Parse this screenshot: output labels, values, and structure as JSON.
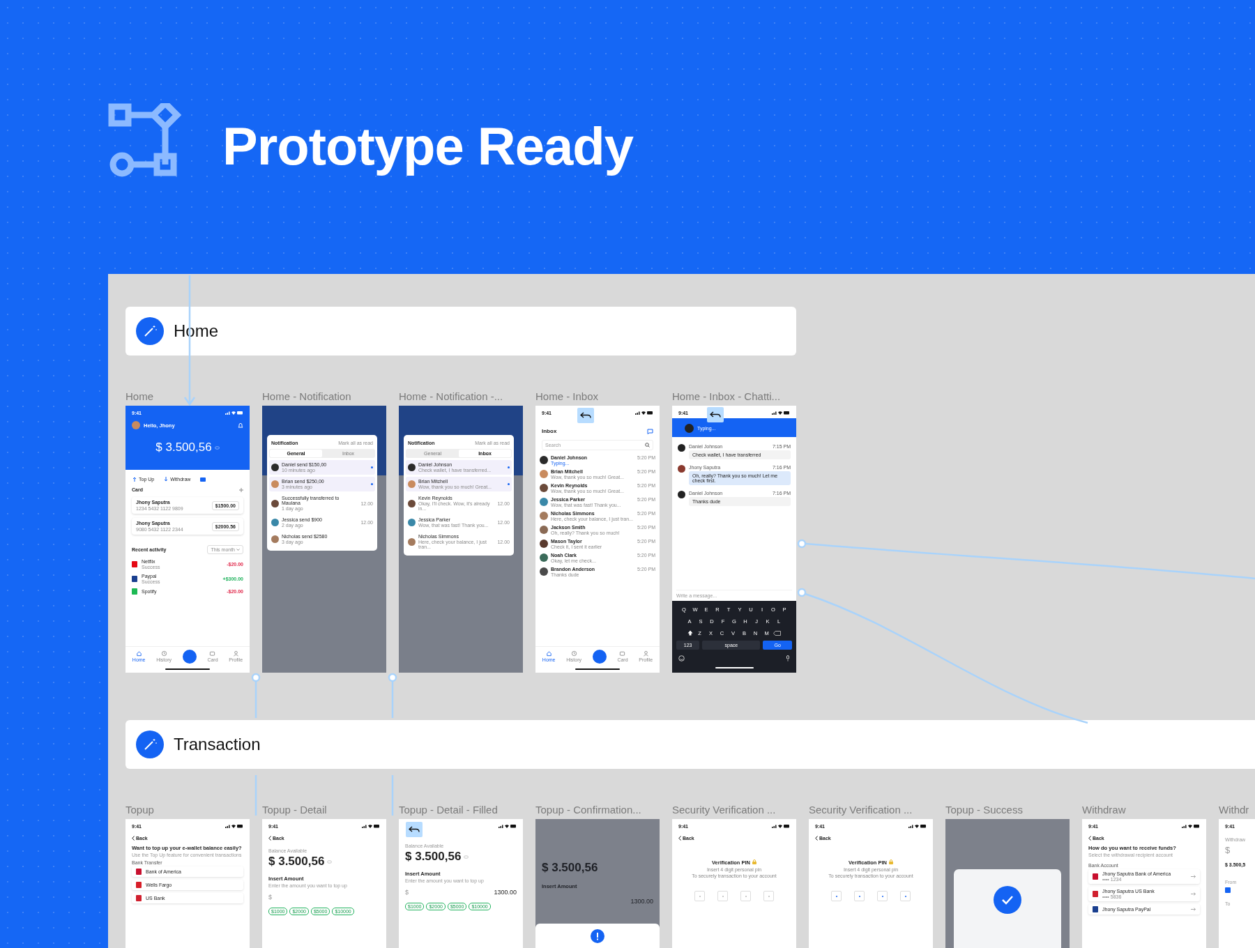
{
  "header": {
    "title": "Prototype Ready"
  },
  "sections": [
    {
      "title": "Home",
      "frames": [
        {
          "label": "Home",
          "kind": "home",
          "time": "9:41",
          "greeting": "Hello, Jhony",
          "balance": "$ 3.500,56",
          "actions": [
            "Top Up",
            "Withdraw"
          ],
          "card_title": "Card",
          "cards": [
            {
              "name": "Jhony Saputra",
              "number": "1234 5432 1122 9809",
              "amount": "$1500.00"
            },
            {
              "name": "Jhony Saputra",
              "number": "9080 5432 1122 2344",
              "amount": "$2000.56"
            }
          ],
          "activity_title": "Recent activity",
          "filter": "This month",
          "activities": [
            {
              "name": "Netflix",
              "status": "Success",
              "amount": "-$20.00",
              "kind": "expense"
            },
            {
              "name": "Paypal",
              "status": "Success",
              "amount": "+$300.00",
              "kind": "income"
            },
            {
              "name": "Spotify",
              "amount": "-$20.00",
              "kind": "expense"
            }
          ],
          "tabs": [
            {
              "label": "Home",
              "selected": true
            },
            {
              "label": "History",
              "selected": false
            },
            {
              "label": "Card",
              "selected": false
            },
            {
              "label": "Profile",
              "selected": false
            }
          ]
        },
        {
          "label": "Home -  Notification",
          "kind": "notification",
          "title": "Notification",
          "link": "Mark all as read",
          "tabs": [
            {
              "label": "General",
              "selected": true
            },
            {
              "label": "Inbox",
              "selected": false
            }
          ],
          "items": [
            {
              "text": "Daniel send $150,00",
              "sub": "10 minutes ago",
              "unread": true
            },
            {
              "text": "Brian send $250,00",
              "sub": "3 minutes ago",
              "unread": true
            },
            {
              "text": "Successfully transferred to Maulana",
              "sub": "1 day ago",
              "time": "12.00",
              "unread": false
            },
            {
              "text": "Jessica send $900",
              "sub": "2 day ago",
              "time": "12.00",
              "unread": false
            },
            {
              "text": "Nicholas send $2580",
              "sub": "3 day ago",
              "unread": false
            }
          ]
        },
        {
          "label": "Home -  Notification -...",
          "kind": "notification",
          "title": "Notification",
          "link": "Mark all as read",
          "tabs": [
            {
              "label": "General",
              "selected": false
            },
            {
              "label": "Inbox",
              "selected": true
            }
          ],
          "items": [
            {
              "text": "Daniel Johnson",
              "sub": "Check wallet, I have transferred...",
              "unread": true
            },
            {
              "text": "Brian Mitchell",
              "sub": "Wow, thank you so much! Great...",
              "unread": true
            },
            {
              "text": "Kevin Reynolds",
              "sub": "Okay, I'll check. Wow, it's already in...",
              "time": "12.00",
              "unread": false
            },
            {
              "text": "Jessica Parker",
              "sub": "Wow, that was fast! Thank you...",
              "time": "12.00",
              "unread": false
            },
            {
              "text": "Nicholas Simmons",
              "sub": "Here, check your balance, I just tran...",
              "time": "12.00",
              "unread": false
            }
          ]
        },
        {
          "label": "Home - Inbox",
          "kind": "inbox",
          "time": "9:41",
          "title": "Inbox",
          "search": "Search",
          "items": [
            {
              "name": "Daniel Johnson",
              "message": "Typing...",
              "typing": true,
              "time": "5:20 PM"
            },
            {
              "name": "Brian Mitchell",
              "message": "Wow, thank you so much! Great...",
              "typing": false,
              "time": "5:20 PM"
            },
            {
              "name": "Kevin Reynolds",
              "message": "Wow, thank you so much! Great...",
              "typing": false,
              "time": "5:20 PM"
            },
            {
              "name": "Jessica Parker",
              "message": "Wow, that was fast! Thank you...",
              "typing": false,
              "time": "5:20 PM"
            },
            {
              "name": "Nicholas Simmons",
              "message": "Here, check your balance, I just tran...",
              "typing": false,
              "time": "5:20 PM"
            },
            {
              "name": "Jackson Smith",
              "message": "Oh, really? Thank you so much!",
              "typing": false,
              "time": "5:20 PM"
            },
            {
              "name": "Mason Taylor",
              "message": "Check it, I sent it earlier",
              "typing": false,
              "time": "5:20 PM"
            },
            {
              "name": "Noah Clark",
              "message": "Okay, let me check...",
              "typing": false,
              "time": "5:20 PM"
            },
            {
              "name": "Brandon Anderson",
              "message": "Thanks dude",
              "typing": false,
              "time": "5:20 PM"
            }
          ],
          "tabs": [
            {
              "label": "Home",
              "selected": true
            },
            {
              "label": "History",
              "selected": false
            },
            {
              "label": "Card",
              "selected": false
            },
            {
              "label": "Profile",
              "selected": false
            }
          ]
        },
        {
          "label": "Home - Inbox - Chatti...",
          "kind": "chat",
          "time": "9:41",
          "status": "Typing...",
          "messages": [
            {
              "name": "Daniel Johnson",
              "time": "7:15 PM",
              "text": "Check wallet, I have transferred",
              "mine": false
            },
            {
              "name": "Jhony Saputra",
              "time": "7:16 PM",
              "text": "Oh, really? Thank you so much! Let me check first.",
              "mine": true
            },
            {
              "name": "Daniel Johnson",
              "time": "7:16 PM",
              "text": "Thanks dude",
              "mine": false
            }
          ],
          "input": "Write a message...",
          "keys": [
            [
              "Q",
              "W",
              "E",
              "R",
              "T",
              "Y",
              "U",
              "I",
              "O",
              "P"
            ],
            [
              "A",
              "S",
              "D",
              "F",
              "G",
              "H",
              "J",
              "K",
              "L"
            ],
            [
              "Z",
              "X",
              "C",
              "V",
              "B",
              "N",
              "M"
            ]
          ],
          "numbers_key": "123",
          "space_key": "space",
          "go_key": "Go"
        }
      ]
    },
    {
      "title": "Transaction",
      "frames": [
        {
          "label": "Topup",
          "kind": "topup",
          "time": "9:41",
          "back": "Back",
          "title": "Want to top up your e-wallet balance easily?",
          "subtitle": "Use the Top Up feature for convenient transactions",
          "group": "Bank Transfer",
          "banks": [
            "Bank of America",
            "Wells Fargo",
            "US Bank"
          ]
        },
        {
          "label": "Topup - Detail",
          "kind": "detail",
          "time": "9:41",
          "back": "Back",
          "caption": "Balance Available",
          "balance": "$ 3.500,56",
          "heading": "Insert Amount",
          "hint": "Enter the amount you want to top up",
          "currency": "$",
          "chips": [
            "$1000",
            "$2000",
            "$5000",
            "$10000"
          ]
        },
        {
          "label": "Topup - Detail - Filled",
          "kind": "detail",
          "caption": "Balance Available",
          "balance": "$ 3.500,56",
          "heading": "Insert Amount",
          "hint": "Enter the amount you want to top up",
          "currency": "$",
          "amount": "1300.00",
          "chips": [
            "$1000",
            "$2000",
            "$5000",
            "$10000"
          ]
        },
        {
          "label": "Topup - Confirmation...",
          "kind": "confirmation",
          "balance": "$ 3.500,56",
          "heading": "Insert Amount",
          "amount": "1300.00"
        },
        {
          "label": "Security Verification ...",
          "kind": "pin",
          "time": "9:41",
          "back": "Back",
          "title": "Verification PIN",
          "hint": "Insert 4 digit personal pin",
          "subhint": "To securely transaction to your account",
          "pins": [
            false,
            false,
            false,
            false
          ]
        },
        {
          "label": "Security Verification ...",
          "kind": "pin",
          "time": "9:41",
          "back": "Back",
          "title": "Verification PIN",
          "hint": "Insert 4 digit personal pin",
          "subhint": "To securely transaction to your account",
          "pins": [
            true,
            true,
            true,
            true
          ]
        },
        {
          "label": "Topup - Success",
          "kind": "success"
        },
        {
          "label": "Withdraw",
          "kind": "withdraw",
          "time": "9:41",
          "back": "Back",
          "title": "How do you want to receive funds?",
          "subtitle": "Select the withdrawal recipient account",
          "group": "Bank Account",
          "accounts": [
            {
              "name": "Jhony Saputra Bank of America",
              "number": "•••• 1234"
            },
            {
              "name": "Jhony Saputra US Bank",
              "number": "•••• 5836"
            },
            {
              "name": "Jhony Saputra PayPal"
            }
          ]
        },
        {
          "label": "Withdr",
          "kind": "withdraw_amount",
          "time": "9:41",
          "caption": "Withdraw",
          "currency": "$",
          "balance": "$ 3.500,5",
          "from": "From",
          "to": "To"
        }
      ]
    }
  ]
}
